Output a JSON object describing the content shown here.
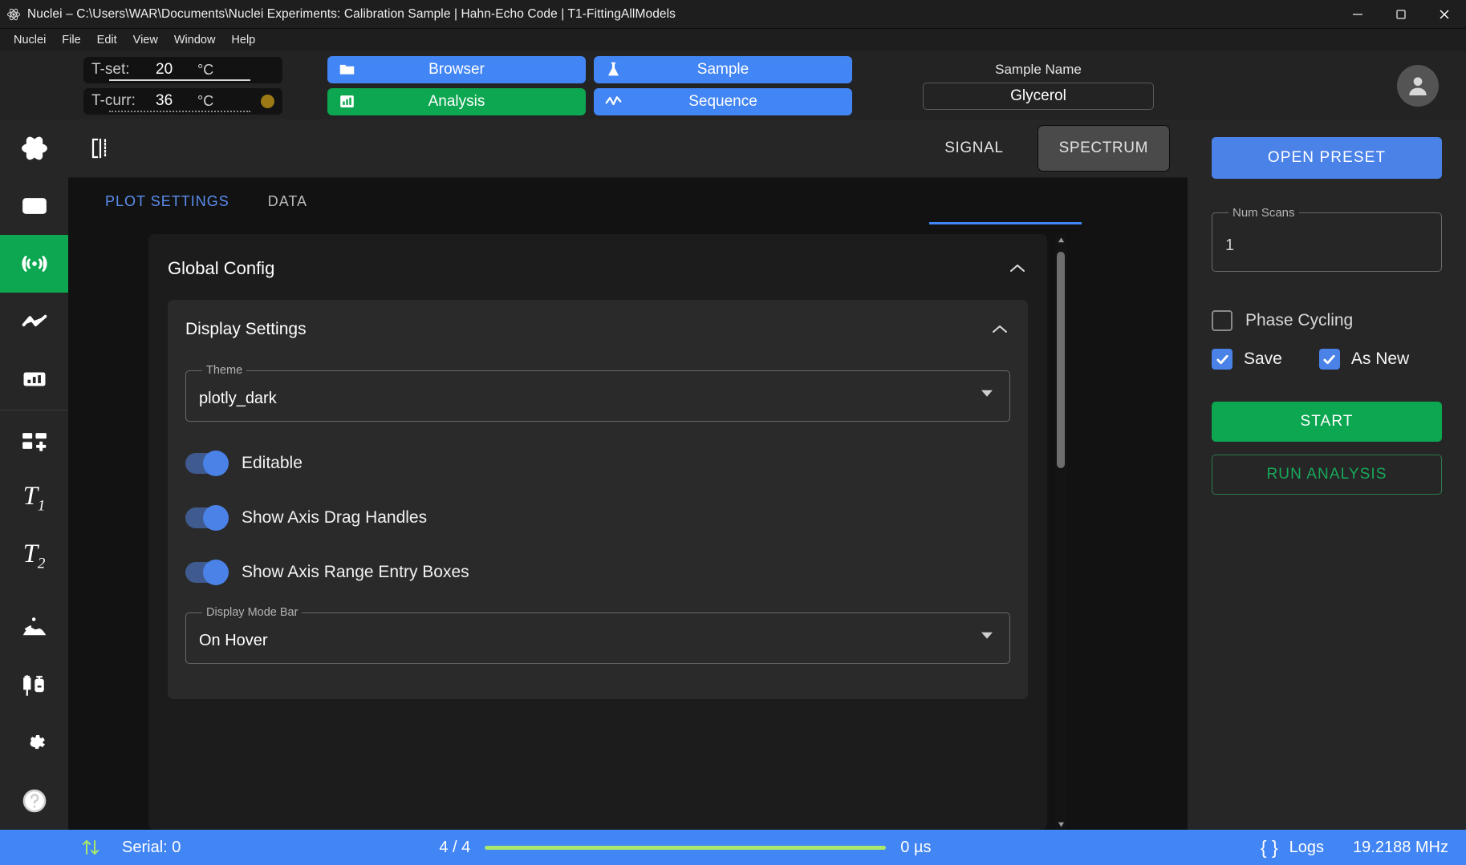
{
  "window": {
    "title": "Nuclei – C:\\Users\\WAR\\Documents\\Nuclei Experiments: Calibration Sample | Hahn-Echo Code | T1-FittingAllModels",
    "app_icon": "atom-icon",
    "minimize_label": "minimize-icon",
    "maximize_label": "maximize-icon",
    "close_label": "close-icon"
  },
  "menubar": {
    "items": [
      {
        "label": "Nuclei"
      },
      {
        "label": "File"
      },
      {
        "label": "Edit"
      },
      {
        "label": "View"
      },
      {
        "label": "Window"
      },
      {
        "label": "Help"
      }
    ]
  },
  "topbar": {
    "temp_set": {
      "label": "T-set:",
      "value": "20",
      "unit": "°C"
    },
    "temp_curr": {
      "label": "T-curr:",
      "value": "36",
      "unit": "°C",
      "status_color": "#9c7914"
    },
    "nav": [
      {
        "label": "Browser",
        "icon": "folder-icon",
        "color": "#4285f4"
      },
      {
        "label": "Sample",
        "icon": "flask-icon",
        "color": "#4285f4"
      },
      {
        "label": "Analysis",
        "icon": "bar-chart-icon",
        "color": "#0ca750"
      },
      {
        "label": "Sequence",
        "icon": "waveform-icon",
        "color": "#4285f4"
      }
    ],
    "sample_name": {
      "label": "Sample Name",
      "value": "Glycerol"
    },
    "avatar": "account-icon"
  },
  "sidebar": {
    "items": [
      {
        "name": "atom",
        "icon": "atom-icon",
        "active": false
      },
      {
        "name": "browser",
        "icon": "folder-icon",
        "active": false
      },
      {
        "name": "acquire",
        "icon": "signal-icon",
        "active": true
      },
      {
        "name": "sequence",
        "icon": "waveform-icon",
        "active": false
      },
      {
        "name": "analysis",
        "icon": "bar-chart-icon",
        "active": false
      },
      {
        "name": "add-panel",
        "icon": "add-panel-icon",
        "active": false
      },
      {
        "name": "t1",
        "icon": "T1",
        "active": false
      },
      {
        "name": "t2",
        "icon": "T2",
        "active": false
      },
      {
        "name": "construction",
        "icon": "construction-icon",
        "active": false
      },
      {
        "name": "sample-prep",
        "icon": "syringe-vial-icon",
        "active": false
      },
      {
        "name": "settings",
        "icon": "gear-icon",
        "active": false
      },
      {
        "name": "help",
        "icon": "help-icon",
        "active": false
      }
    ]
  },
  "plot_header": {
    "icon": "split-panel-icon",
    "tabs": [
      {
        "label": "SIGNAL",
        "selected": false
      },
      {
        "label": "SPECTRUM",
        "selected": true
      }
    ]
  },
  "tabs": [
    {
      "label": "PLOT SETTINGS",
      "active": true
    },
    {
      "label": "DATA",
      "active": false
    }
  ],
  "panel": {
    "global_config": {
      "title": "Global Config",
      "collapse_icon": "chevron-up-icon",
      "display_settings": {
        "title": "Display Settings",
        "collapse_icon": "chevron-up-icon",
        "theme": {
          "label": "Theme",
          "value": "plotly_dark"
        },
        "toggles": [
          {
            "label": "Editable",
            "on": true
          },
          {
            "label": "Show Axis Drag Handles",
            "on": true
          },
          {
            "label": "Show Axis Range Entry Boxes",
            "on": true
          }
        ],
        "display_mode_bar": {
          "label": "Display Mode Bar",
          "value": "On Hover"
        }
      }
    }
  },
  "right_panel": {
    "open_preset": "OPEN PRESET",
    "num_scans": {
      "label": "Num Scans",
      "value": "1"
    },
    "phase_cycling": {
      "label": "Phase Cycling",
      "checked": false
    },
    "save": {
      "label": "Save",
      "checked": true
    },
    "as_new": {
      "label": "As New",
      "checked": true
    },
    "start": "START",
    "run_analysis": "RUN ANALYSIS"
  },
  "statusbar": {
    "transfer_icon": "up-down-arrows-icon",
    "serial": "Serial: 0",
    "count": "4 / 4",
    "progress_percent": 100,
    "time": "0 µs",
    "logs_icon": "braces-icon",
    "logs": "Logs",
    "frequency": "19.2188 MHz"
  }
}
